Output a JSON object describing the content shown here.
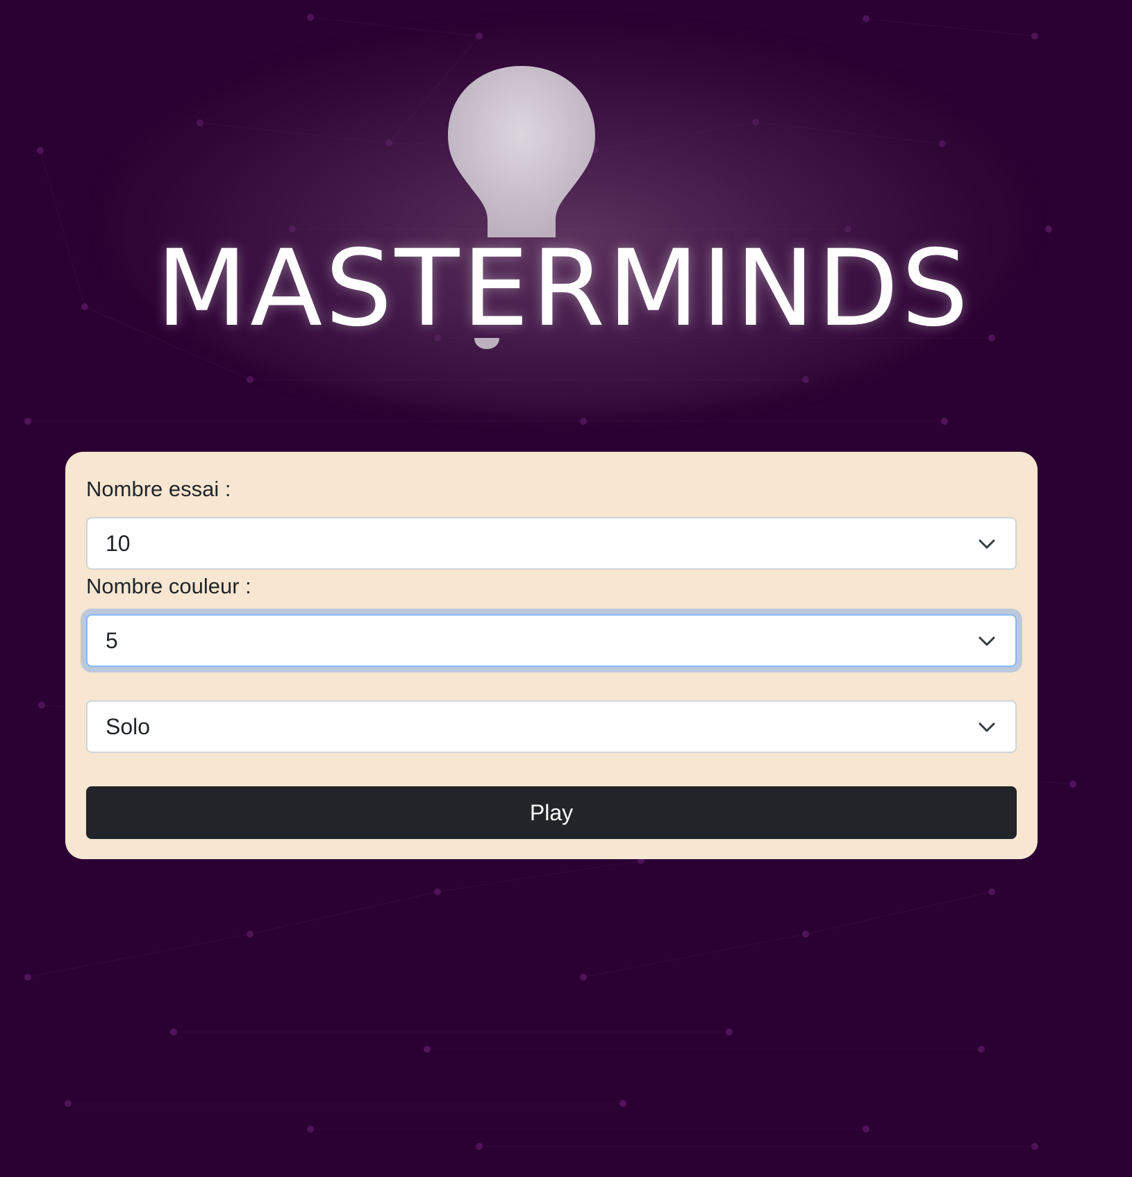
{
  "logo": {
    "text": "MASTERMINDS"
  },
  "form": {
    "tries_label": "Nombre essai :",
    "tries_value": "10",
    "colors_label": "Nombre couleur :",
    "colors_value": "5",
    "mode_value": "Solo",
    "play_label": "Play"
  },
  "colors": {
    "background": "#2b0032",
    "card": "#f7e6d1",
    "button": "#212529",
    "focus": "#86b7fe"
  },
  "icons": [
    "lightbulb-icon",
    "chevron-down-icon"
  ]
}
